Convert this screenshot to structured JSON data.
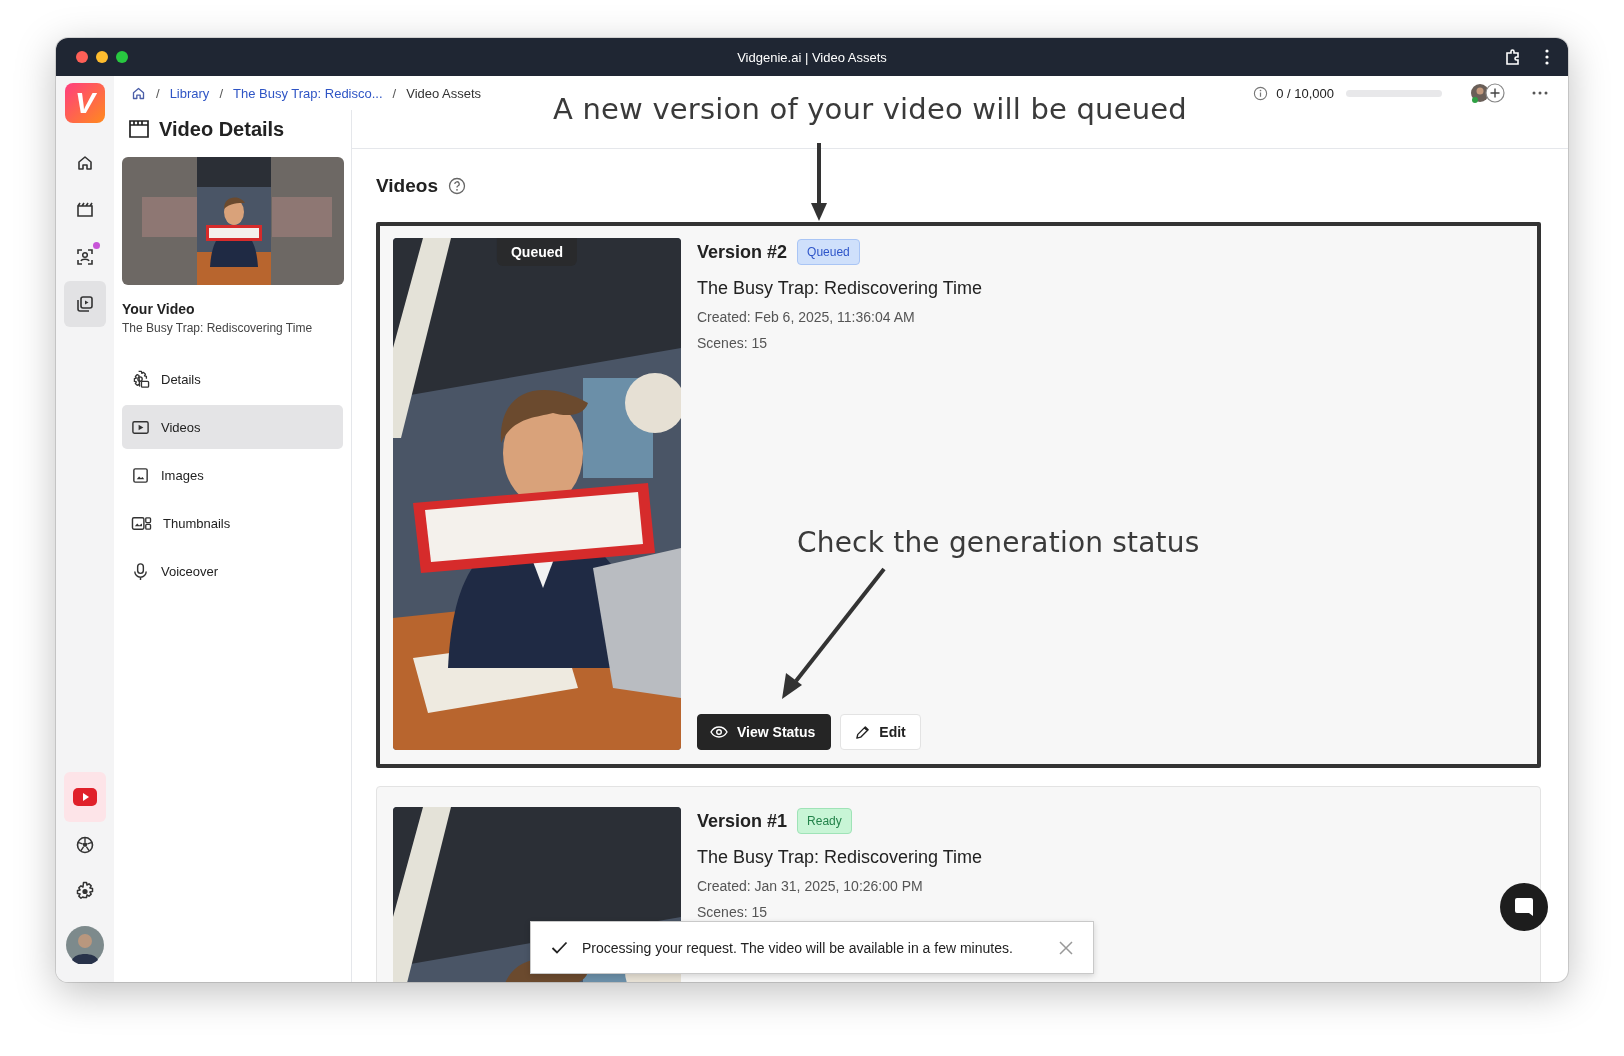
{
  "window": {
    "title": "Vidgenie.ai | Video Assets"
  },
  "rail": {
    "logo": "V",
    "items": [
      {
        "selected": false,
        "notification": false
      },
      {
        "selected": false,
        "notification": false
      },
      {
        "selected": false,
        "notification": true
      },
      {
        "selected": true,
        "notification": false
      }
    ]
  },
  "breadcrumb": {
    "separator": "/",
    "items": [
      {
        "label": "Library",
        "current": false
      },
      {
        "label": "The Busy Trap: Redisco...",
        "current": false
      },
      {
        "label": "Video Assets",
        "current": true
      }
    ]
  },
  "credits": {
    "text": "0 / 10,000"
  },
  "sidebar": {
    "title": "Video Details",
    "heading": "Your Video",
    "subtitle": "The Busy Trap: Rediscovering Time",
    "items": [
      {
        "label": "Details",
        "selected": false
      },
      {
        "label": "Videos",
        "selected": true
      },
      {
        "label": "Images",
        "selected": false
      },
      {
        "label": "Thumbnails",
        "selected": false
      },
      {
        "label": "Voiceover",
        "selected": false
      }
    ]
  },
  "videos": {
    "heading": "Videos",
    "versions": [
      {
        "version": "Version #2",
        "status": "Queued",
        "kind": "queued",
        "highlighted": true,
        "overlay_label": "Queued",
        "title": "The Busy Trap: Rediscovering Time",
        "created": "Created: Feb 6, 2025, 11:36:04 AM",
        "scenes": "Scenes: 15",
        "buttons": [
          {
            "label": "View Status",
            "kind": "primary"
          },
          {
            "label": "Edit",
            "kind": "secondary"
          }
        ]
      },
      {
        "version": "Version #1",
        "status": "Ready",
        "kind": "ready",
        "highlighted": false,
        "title": "The Busy Trap: Rediscovering Time",
        "created": "Created: Jan 31, 2025, 10:26:00 PM",
        "scenes": "Scenes: 15"
      }
    ]
  },
  "annotations": [
    {
      "text": "A new version of your video will be queued"
    },
    {
      "text": "Check the generation status"
    }
  ],
  "toast": {
    "message": "Processing your request. The video will be available in a few minutes."
  }
}
